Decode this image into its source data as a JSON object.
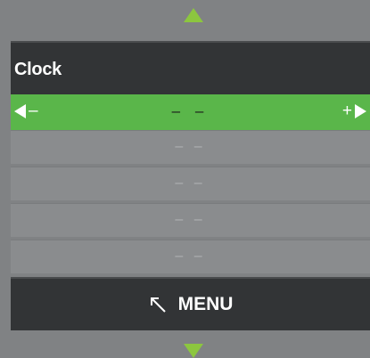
{
  "header": {
    "title": "Clock"
  },
  "selected_row": {
    "minus_label": "–",
    "value": "– –",
    "plus_label": "+"
  },
  "rows": [
    {
      "value": "– –"
    },
    {
      "value": "– –"
    },
    {
      "value": "– –"
    },
    {
      "value": "– –"
    }
  ],
  "footer": {
    "menu_label": "MENU"
  },
  "colors": {
    "accent": "#5ab64a",
    "bar": "#323436",
    "background": "#808284"
  },
  "icons": {
    "scroll_up": "triangle-up-icon",
    "scroll_down": "triangle-down-icon",
    "decrease": "triangle-left-icon",
    "increase": "triangle-right-icon",
    "menu": "arrow-up-left-icon"
  }
}
